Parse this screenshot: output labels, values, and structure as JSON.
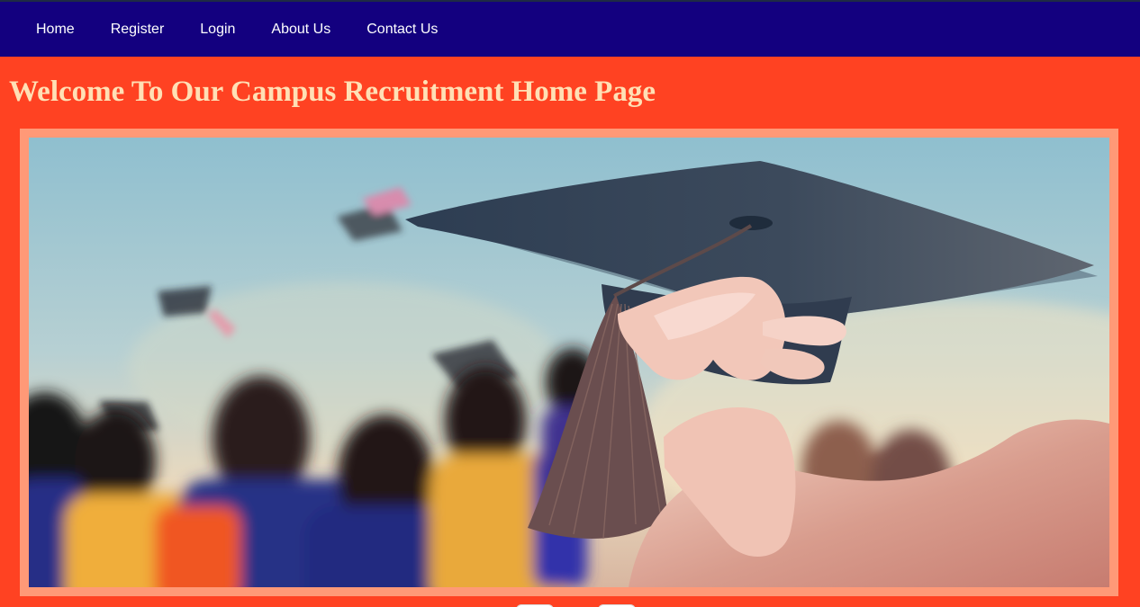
{
  "nav": {
    "items": [
      {
        "label": "Home"
      },
      {
        "label": "Register"
      },
      {
        "label": "Login"
      },
      {
        "label": "About Us"
      },
      {
        "label": "Contact Us"
      }
    ]
  },
  "main": {
    "title": "Welcome To Our Campus Recruitment Home Page"
  },
  "hero": {
    "image": "graduation-cap-hero-image"
  },
  "colors": {
    "nav_background": "#13007f",
    "page_background": "#ff4222",
    "title_text": "#ffe0b5",
    "image_border": "#ff9977",
    "nav_text": "#ffffff"
  }
}
